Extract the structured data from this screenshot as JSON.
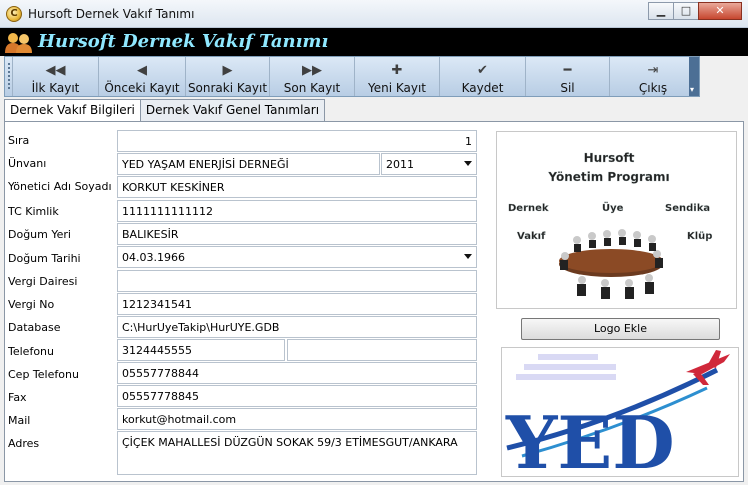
{
  "window": {
    "title": "Hursoft Dernek Vakıf Tanımı",
    "app_icon_glyph": "C"
  },
  "banner": {
    "title": "Hursoft Dernek Vakıf Tanımı"
  },
  "toolbar": {
    "buttons": [
      {
        "label": "İlk Kayıt",
        "icon": "first-record-icon",
        "glyph": "◀◀"
      },
      {
        "label": "Önceki Kayıt",
        "icon": "previous-record-icon",
        "glyph": "◀"
      },
      {
        "label": "Sonraki Kayıt",
        "icon": "next-record-icon",
        "glyph": "▶"
      },
      {
        "label": "Son Kayıt",
        "icon": "last-record-icon",
        "glyph": "▶▶"
      },
      {
        "label": "Yeni Kayıt",
        "icon": "plus-icon",
        "glyph": "✚"
      },
      {
        "label": "Kaydet",
        "icon": "checkmark-icon",
        "glyph": "✔"
      },
      {
        "label": "Sil",
        "icon": "minus-icon",
        "glyph": "━"
      },
      {
        "label": "Çıkış",
        "icon": "exit-door-icon",
        "glyph": "⇥"
      }
    ]
  },
  "tabs": [
    {
      "label": "Dernek Vakıf Bilgileri",
      "active": true
    },
    {
      "label": "Dernek Vakıf Genel Tanımları",
      "active": false
    }
  ],
  "form": {
    "sira": {
      "label": "Sıra",
      "value": "1"
    },
    "unvani": {
      "label": "Ünvanı",
      "value": "YED YAŞAM ENERJİSİ DERNEĞİ",
      "year": "2011"
    },
    "yonetici": {
      "label": "Yönetici Adı Soyadı",
      "value": "KORKUT KESKİNER"
    },
    "tc": {
      "label": "TC Kimlik",
      "value": "1111111111112"
    },
    "dogum_yeri": {
      "label": "Doğum Yeri",
      "value": "BALIKESİR"
    },
    "dogum_tarihi": {
      "label": "Doğum Tarihi",
      "value": "04.03.1966"
    },
    "vergi_dairesi": {
      "label": "Vergi Dairesi",
      "value": ""
    },
    "vergi_no": {
      "label": "Vergi No",
      "value": "1212341541"
    },
    "database": {
      "label": "Database",
      "value": "C:\\HurUyeTakip\\HurUYE.GDB"
    },
    "telefonu": {
      "label": "Telefonu",
      "value": "3124445555",
      "value2": ""
    },
    "cep": {
      "label": "Cep Telefonu",
      "value": "05557778844"
    },
    "fax": {
      "label": "Fax",
      "value": "05557778845"
    },
    "mail": {
      "label": "Mail",
      "value": "korkut@hotmail.com"
    },
    "adres": {
      "label": "Adres",
      "value": "ÇİÇEK MAHALLESİ DÜZGÜN SOKAK 59/3 ETİMESGUT/ANKARA"
    }
  },
  "logo_panel": {
    "title_line1": "Hursoft",
    "title_line2": "Yönetim Programı",
    "word_dernek": "Dernek",
    "word_uye": "Üye",
    "word_sendika": "Sendika",
    "word_vakif": "Vakıf",
    "word_klup": "Klüp",
    "button_label": "Logo Ekle"
  },
  "yed_logo": {
    "text": "YED"
  },
  "colors": {
    "banner_bg": "#000000",
    "banner_text": "#8fe8ff",
    "toolbar_bg": "#c9dbee",
    "yed_blue": "#1f4fa8",
    "plane_red": "#d0283a"
  }
}
